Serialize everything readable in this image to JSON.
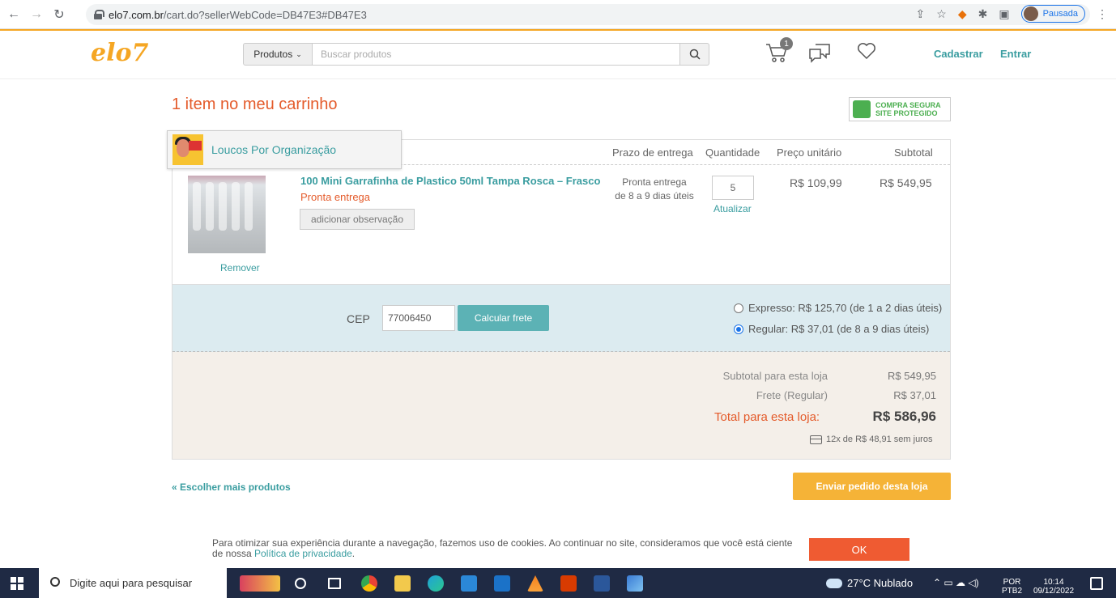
{
  "browser": {
    "url_host": "elo7.com.br",
    "url_path": "/cart.do?sellerWebCode=DB47E3#DB47E3",
    "profile_label": "Pausada"
  },
  "header": {
    "logo": "elo7",
    "category_label": "Produtos",
    "search_placeholder": "Buscar produtos",
    "cart_count": "1",
    "signup_label": "Cadastrar",
    "login_label": "Entrar"
  },
  "page": {
    "title": "1 item no meu carrinho",
    "secure_line1": "COMPRA SEGURA",
    "secure_line2": "SITE PROTEGIDO"
  },
  "store": {
    "name": "Loucos Por Organização"
  },
  "columns": {
    "delivery": "Prazo de entrega",
    "quantity": "Quantidade",
    "unit_price": "Preço unitário",
    "subtotal": "Subtotal"
  },
  "item": {
    "name": "100 Mini Garrafinha de Plastico 50ml Tampa Rosca – Frasco",
    "status": "Pronta entrega",
    "note_button": "adicionar observação",
    "remove": "Remover",
    "delivery_line1": "Pronta entrega",
    "delivery_line2": "de 8 a 9 dias úteis",
    "quantity": "5",
    "update": "Atualizar",
    "unit_price": "R$ 109,99",
    "subtotal": "R$ 549,95"
  },
  "shipping": {
    "cep_label": "CEP",
    "cep_value": "77006450",
    "calc_button": "Calcular frete",
    "options": [
      {
        "label": "Expresso: R$ 125,70 (de 1 a 2 dias úteis)",
        "selected": false
      },
      {
        "label": "Regular: R$ 37,01 (de 8 a 9 dias úteis)",
        "selected": true
      }
    ]
  },
  "totals": {
    "subtotal_label": "Subtotal para esta loja",
    "subtotal_value": "R$ 549,95",
    "freight_label": "Frete (Regular)",
    "freight_value": "R$ 37,01",
    "total_label": "Total para esta loja:",
    "total_value": "R$ 586,96",
    "installments": "12x de R$ 48,91 sem juros"
  },
  "actions": {
    "back_link": "« Escolher mais produtos",
    "send_button": "Enviar pedido desta loja"
  },
  "cookie": {
    "text": "Para otimizar sua experiência durante a navegação, fazemos uso de cookies. Ao continuar no site, consideramos que você está ciente de nossa",
    "link": "Política de privacidade",
    "ok": "OK"
  },
  "taskbar": {
    "search_placeholder": "Digite aqui para pesquisar",
    "weather": "27°C  Nublado",
    "lang1": "POR",
    "lang2": "PTB2",
    "time": "10:14",
    "date": "09/12/2022"
  },
  "colors": {
    "brand_orange": "#f5a623",
    "teal": "#3a9da0",
    "accent_red": "#e45b2b"
  }
}
